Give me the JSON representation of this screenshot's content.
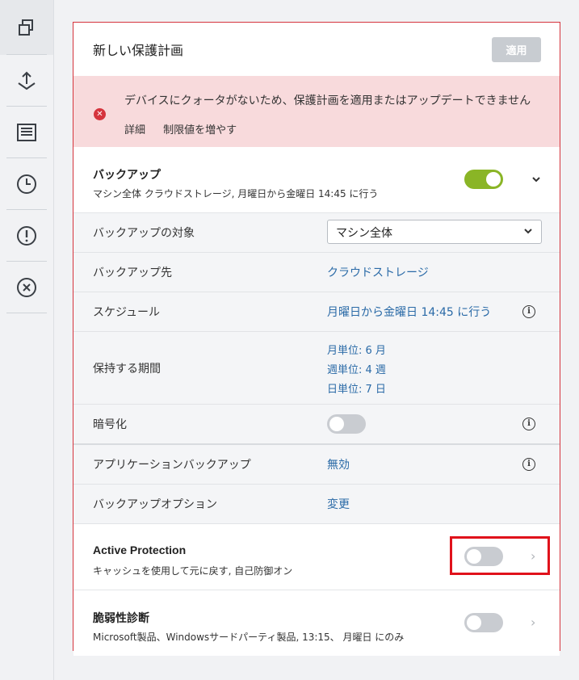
{
  "rail": {
    "items": [
      {
        "icon": "plans-icon"
      },
      {
        "icon": "backup-upload-icon"
      },
      {
        "icon": "report-icon"
      },
      {
        "icon": "clock-icon"
      },
      {
        "icon": "alert-icon"
      },
      {
        "icon": "cancel-icon"
      }
    ]
  },
  "panel": {
    "title": "新しい保護計画",
    "apply_label": "適用"
  },
  "alert": {
    "message": "デバイスにクォータがないため、保護計画を適用またはアップデートできません",
    "link_details": "詳細",
    "link_increase": "制限値を増やす"
  },
  "backup": {
    "title": "バックアップ",
    "subtitle": "マシン全体 クラウドストレージ, 月曜日から金曜日 14:45 に行う",
    "enabled": true,
    "rows": {
      "target_label": "バックアップの対象",
      "target_value": "マシン全体",
      "destination_label": "バックアップ先",
      "destination_value": "クラウドストレージ",
      "schedule_label": "スケジュール",
      "schedule_value": "月曜日から金曜日 14:45 に行う",
      "retention_label": "保持する期間",
      "retention_monthly": "月単位: 6 月",
      "retention_weekly": "週単位: 4 週",
      "retention_daily": "日単位: 7 日",
      "encryption_label": "暗号化",
      "app_backup_label": "アプリケーションバックアップ",
      "app_backup_value": "無効",
      "options_label": "バックアップオプション",
      "options_value": "変更"
    }
  },
  "active_protection": {
    "title": "Active Protection",
    "subtitle": "キャッシュを使用して元に戻す, 自己防御オン",
    "enabled": false
  },
  "vulnerability": {
    "title": "脆弱性診断",
    "subtitle": "Microsoft製品、Windowsサードパーティ製品, 13:15、 月曜日 にのみ",
    "enabled": false
  },
  "colors": {
    "accent_red": "#d5343d",
    "toggle_on": "#8ab526",
    "link_blue": "#2a6aa7",
    "highlight": "#e0121b"
  }
}
